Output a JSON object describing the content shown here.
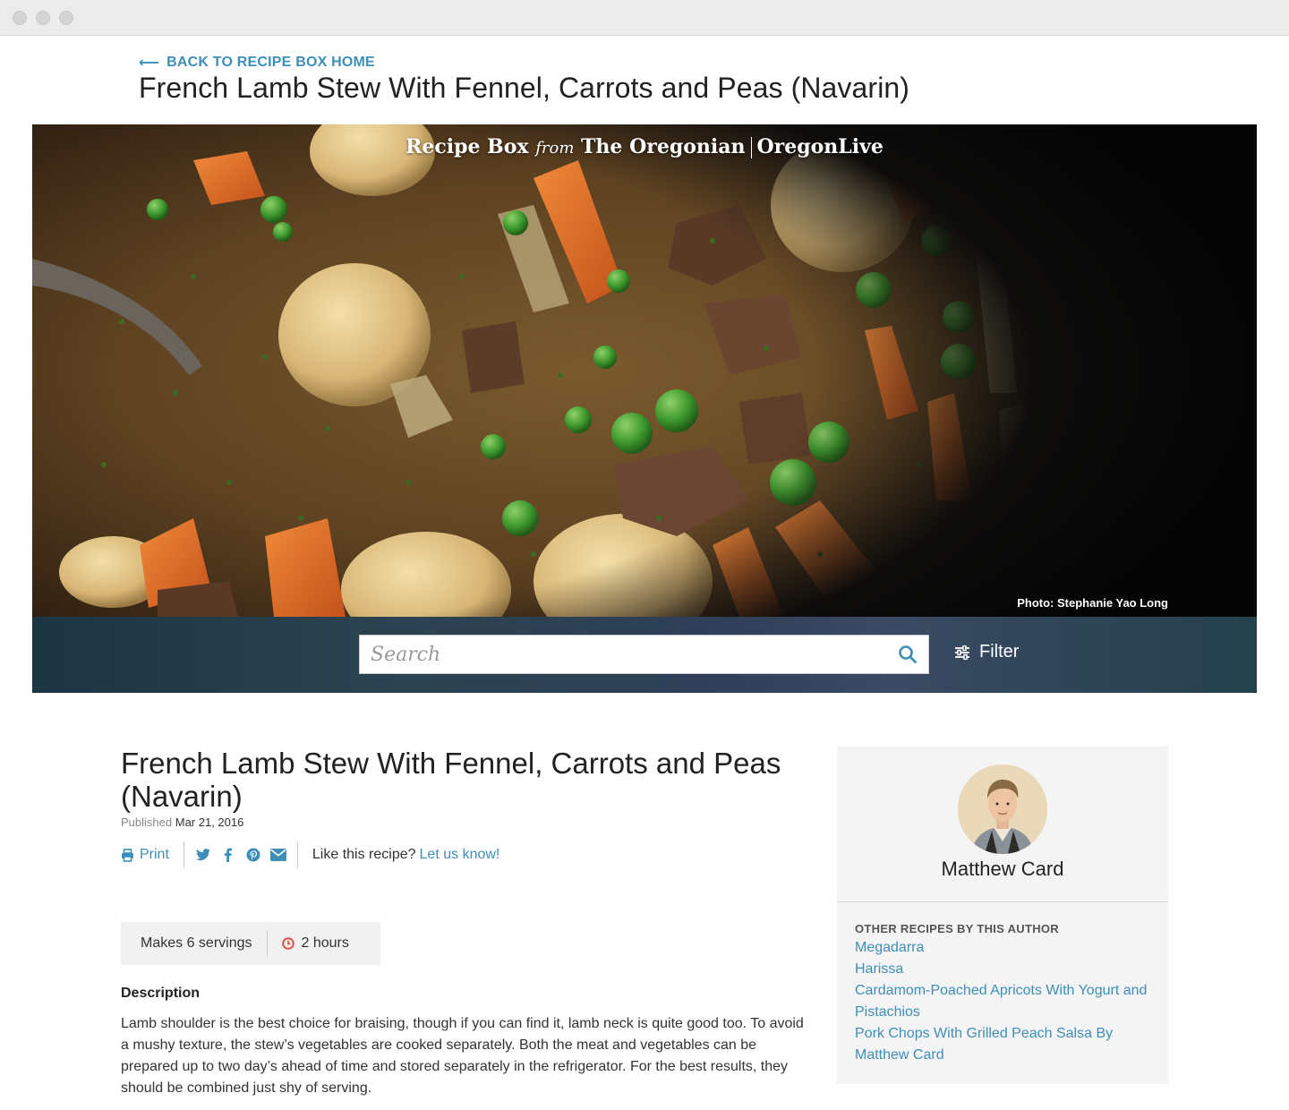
{
  "header": {
    "back_label": "BACK TO RECIPE BOX HOME",
    "title": "French Lamb Stew With Fennel, Carrots and Peas (Navarin)"
  },
  "hero": {
    "brand_recipe_box": "Recipe Box",
    "brand_from": "from",
    "brand_oregonian": "The Oregonian",
    "brand_oregonlive": "OregonLive",
    "photo_credit": "Photo: Stephanie Yao Long"
  },
  "search": {
    "placeholder": "Search",
    "filter_label": "Filter"
  },
  "recipe": {
    "title": "French Lamb Stew With Fennel, Carrots and Peas (Navarin)",
    "published_label": "Published",
    "published_date": "Mar 21, 2016",
    "print_label": "Print",
    "social_icons": [
      "twitter-icon",
      "facebook-icon",
      "pinterest-icon",
      "email-icon"
    ],
    "like_prompt": "Like this recipe?",
    "like_link": "Let us know!",
    "servings": "Makes 6 servings",
    "time": "2 hours",
    "description_heading": "Description",
    "description": "Lamb shoulder is the best choice for braising, though if you can find it, lamb neck is quite good too. To avoid a mushy texture, the stew’s vegetables are cooked separately. Both the meat and vegetables can be prepared up to two day’s ahead of time and stored separately in the refrigerator. For the best results, they should be combined just shy of serving."
  },
  "sidebar": {
    "author_name": "Matthew Card",
    "other_heading": "OTHER RECIPES BY THIS AUTHOR",
    "other_recipes": [
      "Megadarra",
      "Harissa",
      "Cardamom-Poached Apricots With Yogurt and Pistachios",
      "Pork Chops With Grilled Peach Salsa By Matthew Card"
    ]
  },
  "colors": {
    "accent": "#3d8fb8",
    "clock": "#d9534f"
  }
}
